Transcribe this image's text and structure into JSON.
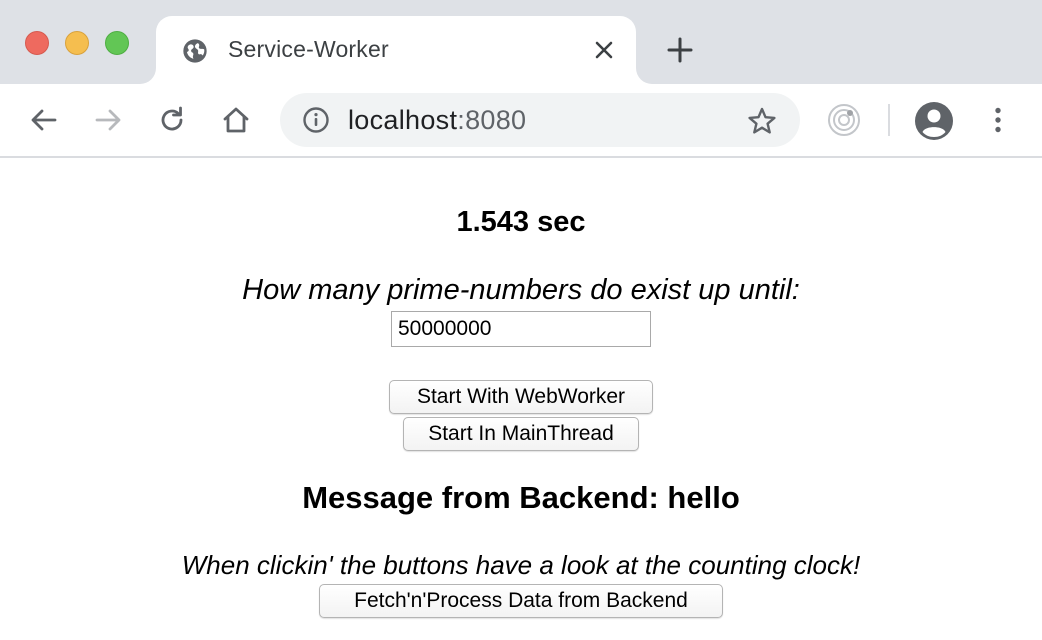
{
  "window": {
    "controls": [
      "close",
      "minimize",
      "maximize"
    ]
  },
  "tab": {
    "title": "Service-Worker",
    "favicon": "globe-icon"
  },
  "toolbar": {
    "url_host": "localhost",
    "url_port": ":8080",
    "icons": [
      "back-arrow-icon",
      "forward-arrow-icon",
      "reload-icon",
      "home-icon",
      "info-icon",
      "star-icon",
      "extension-icon",
      "account-icon",
      "more-vert-icon"
    ]
  },
  "page": {
    "clock": "1.543 sec",
    "question": "How many prime-numbers do exist up until:",
    "input_value": "50000000",
    "btn_worker": "Start With WebWorker",
    "btn_main": "Start In MainThread",
    "message": "Message from Backend: hello",
    "hint": "When clickin' the buttons have a look at the counting clock!",
    "btn_fetch": "Fetch'n'Process Data from Backend"
  },
  "colors": {
    "tabstrip_bg": "#dee1e6",
    "omnibox_bg": "#f1f3f4",
    "traffic_red": "#ee6a5f",
    "traffic_yellow": "#f5be4f",
    "traffic_green": "#62c655"
  }
}
